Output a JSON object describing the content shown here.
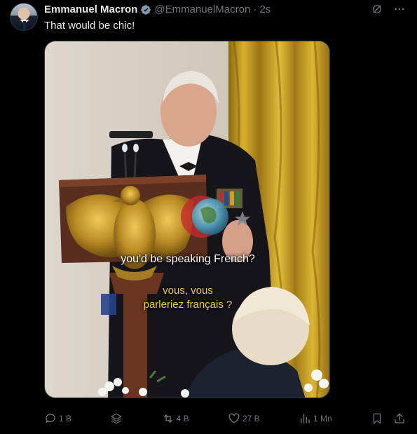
{
  "author": {
    "name": "Emmanuel Macron",
    "handle": "@EmmanuelMacron",
    "separator": "·",
    "time": "2s"
  },
  "tweet": {
    "text": "That would be chic!"
  },
  "media": {
    "subtitle_en": "you'd be speaking French?",
    "subtitle_fr_line1": "vous, vous",
    "subtitle_fr_line2": "parleriez français ?"
  },
  "actions": {
    "replies": "1 B",
    "retweets": "4 B",
    "likes": "27 B",
    "views": "1 Mn"
  },
  "icons": {
    "verified": "verified-badge-icon",
    "grok": "grok-icon",
    "more": "more-icon",
    "reply": "reply-icon",
    "layers": "layers-icon",
    "retweet": "retweet-icon",
    "like": "heart-icon",
    "views": "views-icon",
    "bookmark": "bookmark-icon",
    "share": "share-icon"
  },
  "colors": {
    "background": "#000000",
    "text_primary": "#e7e9ea",
    "text_secondary": "#71767b",
    "verified": "#829aab",
    "subtitle_fr": "#f2cf2a"
  }
}
